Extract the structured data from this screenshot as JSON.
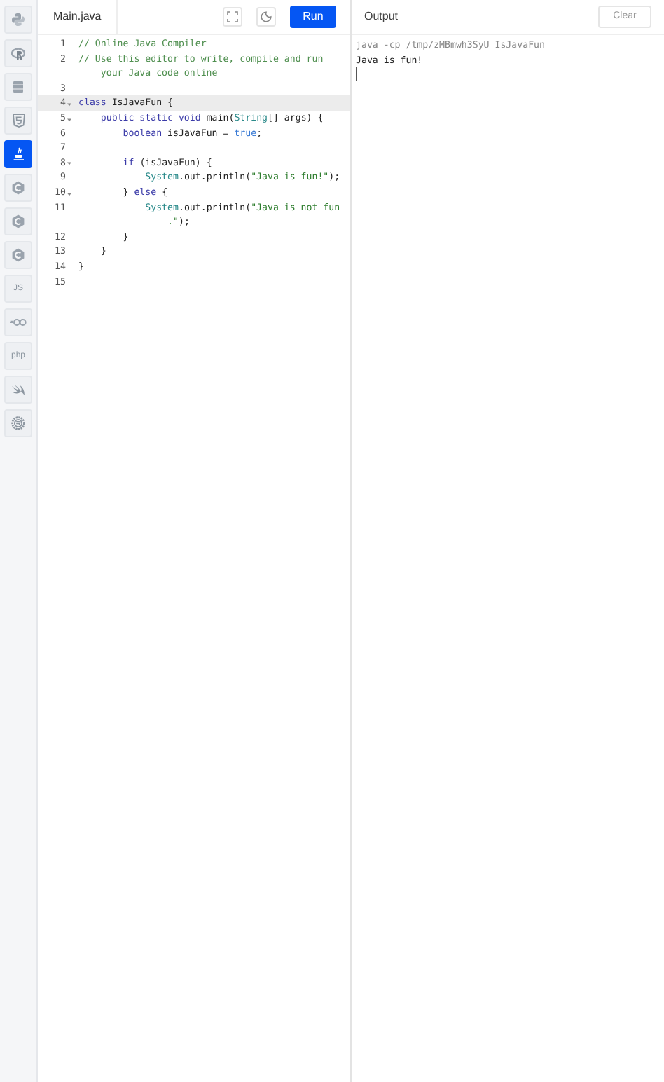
{
  "sidebar": {
    "items": [
      {
        "kind": "python",
        "selected": false
      },
      {
        "kind": "r",
        "selected": false
      },
      {
        "kind": "database",
        "selected": false
      },
      {
        "kind": "html",
        "selected": false
      },
      {
        "kind": "java",
        "selected": true
      },
      {
        "kind": "c",
        "selected": false
      },
      {
        "kind": "c",
        "selected": false
      },
      {
        "kind": "c",
        "selected": false
      },
      {
        "kind": "text",
        "label": "JS",
        "selected": false
      },
      {
        "kind": "go",
        "selected": false
      },
      {
        "kind": "text",
        "label": "php",
        "selected": false
      },
      {
        "kind": "swift",
        "selected": false
      },
      {
        "kind": "rust",
        "selected": false
      }
    ]
  },
  "editor": {
    "tab": "Main.java",
    "run_button": "Run",
    "lines": [
      {
        "number": "1",
        "fold": false,
        "active": false,
        "rows": [
          [
            {
              "kind": "comment",
              "text": "// Online Java Compiler"
            }
          ]
        ]
      },
      {
        "number": "2",
        "fold": false,
        "active": false,
        "rows": [
          [
            {
              "kind": "comment",
              "text": "// Use this editor to write, compile and run"
            }
          ],
          [
            {
              "kind": "comment",
              "text": "    your Java code online"
            }
          ]
        ]
      },
      {
        "number": "3",
        "fold": false,
        "active": false,
        "rows": [
          []
        ]
      },
      {
        "number": "4",
        "fold": true,
        "active": true,
        "rows": [
          [
            {
              "kind": "keyword",
              "text": "class"
            },
            {
              "kind": "plain",
              "text": " IsJavaFun {"
            }
          ]
        ]
      },
      {
        "number": "5",
        "fold": true,
        "active": false,
        "rows": [
          [
            {
              "kind": "plain",
              "text": "    "
            },
            {
              "kind": "keyword",
              "text": "public static void"
            },
            {
              "kind": "plain",
              "text": " main("
            },
            {
              "kind": "type",
              "text": "String"
            },
            {
              "kind": "plain",
              "text": "[] args) {"
            }
          ]
        ]
      },
      {
        "number": "6",
        "fold": false,
        "active": false,
        "rows": [
          [
            {
              "kind": "plain",
              "text": "        "
            },
            {
              "kind": "keyword",
              "text": "boolean"
            },
            {
              "kind": "plain",
              "text": " isJavaFun = "
            },
            {
              "kind": "literal",
              "text": "true"
            },
            {
              "kind": "plain",
              "text": ";"
            }
          ]
        ]
      },
      {
        "number": "7",
        "fold": false,
        "active": false,
        "rows": [
          []
        ]
      },
      {
        "number": "8",
        "fold": true,
        "active": false,
        "rows": [
          [
            {
              "kind": "plain",
              "text": "        "
            },
            {
              "kind": "keyword",
              "text": "if"
            },
            {
              "kind": "plain",
              "text": " (isJavaFun) {"
            }
          ]
        ]
      },
      {
        "number": "9",
        "fold": false,
        "active": false,
        "rows": [
          [
            {
              "kind": "plain",
              "text": "            "
            },
            {
              "kind": "type",
              "text": "System"
            },
            {
              "kind": "plain",
              "text": ".out.println("
            },
            {
              "kind": "string",
              "text": "\"Java is fun!\""
            },
            {
              "kind": "plain",
              "text": ");"
            }
          ]
        ]
      },
      {
        "number": "10",
        "fold": true,
        "active": false,
        "rows": [
          [
            {
              "kind": "plain",
              "text": "        } "
            },
            {
              "kind": "keyword",
              "text": "else"
            },
            {
              "kind": "plain",
              "text": " {"
            }
          ]
        ]
      },
      {
        "number": "11",
        "fold": false,
        "active": false,
        "rows": [
          [
            {
              "kind": "plain",
              "text": "            "
            },
            {
              "kind": "type",
              "text": "System"
            },
            {
              "kind": "plain",
              "text": ".out.println("
            },
            {
              "kind": "string",
              "text": "\"Java is not fun"
            }
          ],
          [
            {
              "kind": "string",
              "text": "                ."
            },
            {
              "kind": "string",
              "text": "\""
            },
            {
              "kind": "plain",
              "text": ");"
            }
          ]
        ]
      },
      {
        "number": "12",
        "fold": false,
        "active": false,
        "rows": [
          [
            {
              "kind": "plain",
              "text": "        }"
            }
          ]
        ]
      },
      {
        "number": "13",
        "fold": false,
        "active": false,
        "rows": [
          [
            {
              "kind": "plain",
              "text": "    }"
            }
          ]
        ]
      },
      {
        "number": "14",
        "fold": false,
        "active": false,
        "rows": [
          [
            {
              "kind": "plain",
              "text": "}"
            }
          ]
        ]
      },
      {
        "number": "15",
        "fold": false,
        "active": false,
        "rows": [
          []
        ]
      }
    ]
  },
  "output": {
    "title": "Output",
    "clear_button": "Clear",
    "lines": [
      {
        "kind": "command",
        "text": "java -cp /tmp/zMBmwh3SyU IsJavaFun"
      },
      {
        "kind": "stdout",
        "text": "Java is fun!"
      }
    ]
  }
}
